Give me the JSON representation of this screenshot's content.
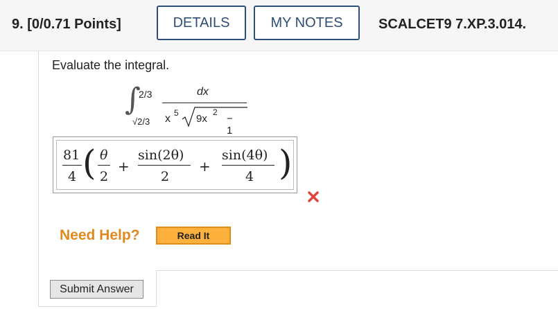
{
  "header": {
    "question_number": "9.",
    "points": "[0/0.71 Points]",
    "details_label": "DETAILS",
    "my_notes_label": "MY NOTES",
    "problem_code": "SCALCET9 7.XP.3.014."
  },
  "problem": {
    "prompt": "Evaluate the integral.",
    "integral": {
      "upper_limit": "2/3",
      "lower_limit": "√2/3",
      "numerator": "dx",
      "denominator_x": "x",
      "denominator_x_power": "5",
      "radicand_base": "9x",
      "radicand_power": "2",
      "radicand_rest": "− 1"
    }
  },
  "answer": {
    "coef_num": "81",
    "coef_den": "4",
    "t1_num": "θ",
    "t1_den": "2",
    "plus1": "+",
    "t2_num": "sin(2θ)",
    "t2_den": "2",
    "plus2": "+",
    "t3_num": "sin(4θ)",
    "t3_den": "4",
    "status_icon": "x-mark-icon",
    "status_color": "#e0443a"
  },
  "help": {
    "need_help_label": "Need Help?",
    "read_it_label": "Read It"
  },
  "submit_label": "Submit Answer"
}
